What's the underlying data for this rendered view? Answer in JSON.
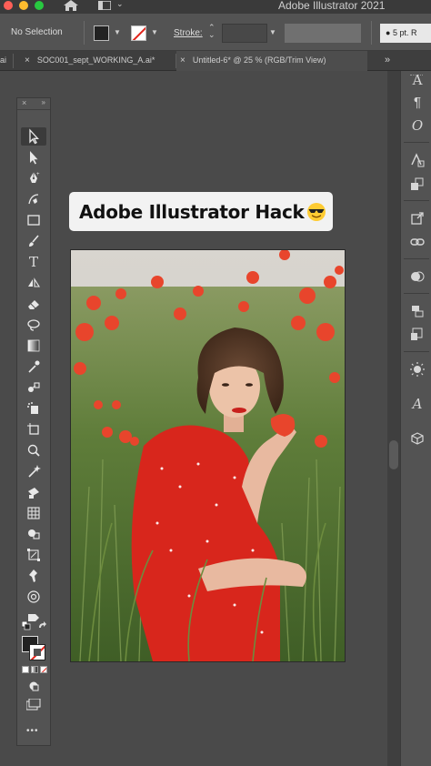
{
  "titlebar": {
    "app_title": "Adobe Illustrator 2021",
    "chevron": "⌄"
  },
  "controlbar": {
    "selection_label": "No Selection",
    "stroke_label": "Stroke:",
    "stroke_value": "",
    "brush_value": "5 pt. R"
  },
  "tabs": [
    {
      "label": "ai",
      "close": ""
    },
    {
      "label": "SOC001_sept_WORKING_A.ai*",
      "close": ""
    },
    {
      "label": "Untitled-6* @ 25 % (RGB/Trim View)",
      "close": "×"
    }
  ],
  "tabbar": {
    "overflow": "»"
  },
  "toolbar": {
    "close": "×",
    "collapse": "»",
    "tools": [
      "selection-tool",
      "direct-selection-tool",
      "pen-tool",
      "curvature-tool",
      "rectangle-tool",
      "paintbrush-tool",
      "type-tool",
      "reflect-tool",
      "eraser-tool",
      "lasso-tool",
      "gradient-tool",
      "eyedropper-tool",
      "blend-tool",
      "symbol-sprayer-tool",
      "artboard-tool",
      "zoom-tool",
      "magic-wand-tool",
      "live-paint-tool",
      "mesh-tool",
      "shape-builder-tool",
      "free-transform-tool",
      "puppet-warp-tool",
      "width-tool",
      "perspective-grid-tool"
    ],
    "more": "•••"
  },
  "banner": {
    "text": "Adobe Illustrator Hack",
    "emoji": "sunglasses-emoji"
  },
  "photo": {
    "subject": "woman-in-red-dress-in-poppy-field"
  },
  "rightdock": {
    "icons": [
      "character-icon",
      "paragraph-icon",
      "opentype-icon",
      "appearance-icon",
      "graphic-styles-icon",
      "transform-icon",
      "links-icon",
      "pathfinder-icon",
      "align-icon",
      "artboards-icon",
      "color-guide-icon",
      "glyphs-icon",
      "3d-icon"
    ]
  },
  "colors": {
    "panel": "#535353",
    "canvas": "#4a4a4a",
    "banner_bg": "#f2f2f2",
    "stroke_none_red": "#e2231a"
  }
}
